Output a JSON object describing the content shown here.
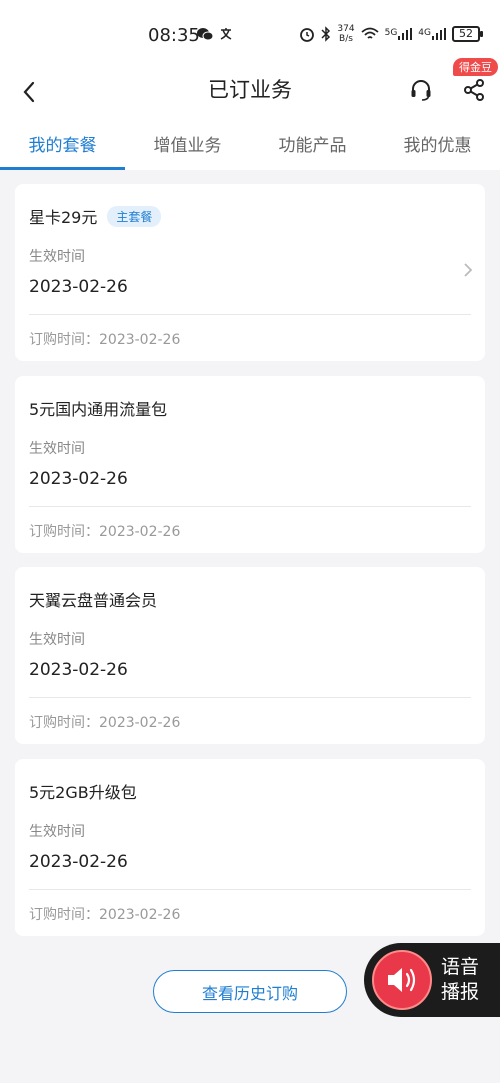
{
  "status_bar": {
    "time": "08:35",
    "netspeed_value": "374",
    "netspeed_unit": "B/s",
    "signal_1": "5G",
    "signal_2": "4G",
    "battery": "52"
  },
  "nav": {
    "title": "已订业务",
    "badge": "得金豆"
  },
  "tabs": [
    {
      "label": "我的套餐",
      "active": true
    },
    {
      "label": "增值业务",
      "active": false
    },
    {
      "label": "功能产品",
      "active": false
    },
    {
      "label": "我的优惠",
      "active": false
    }
  ],
  "cards": [
    {
      "title": "星卡29元",
      "tag": "主套餐",
      "effective_label": "生效时间",
      "effective_date": "2023-02-26",
      "order_time": "订购时间：2023-02-26"
    },
    {
      "title": "5元国内通用流量包",
      "effective_label": "生效时间",
      "effective_date": "2023-02-26",
      "order_time": "订购时间：2023-02-26"
    },
    {
      "title": "天翼云盘普通会员",
      "effective_label": "生效时间",
      "effective_date": "2023-02-26",
      "order_time": "订购时间：2023-02-26"
    },
    {
      "title": "5元2GB升级包",
      "effective_label": "生效时间",
      "effective_date": "2023-02-26",
      "order_time": "订购时间：2023-02-26"
    }
  ],
  "history_button": "查看历史订购",
  "voice_widget": {
    "line1": "语音",
    "line2": "播报"
  },
  "colors": {
    "accent": "#1f7ed1",
    "badge": "#f04b4b",
    "voice": "#e8384a"
  }
}
